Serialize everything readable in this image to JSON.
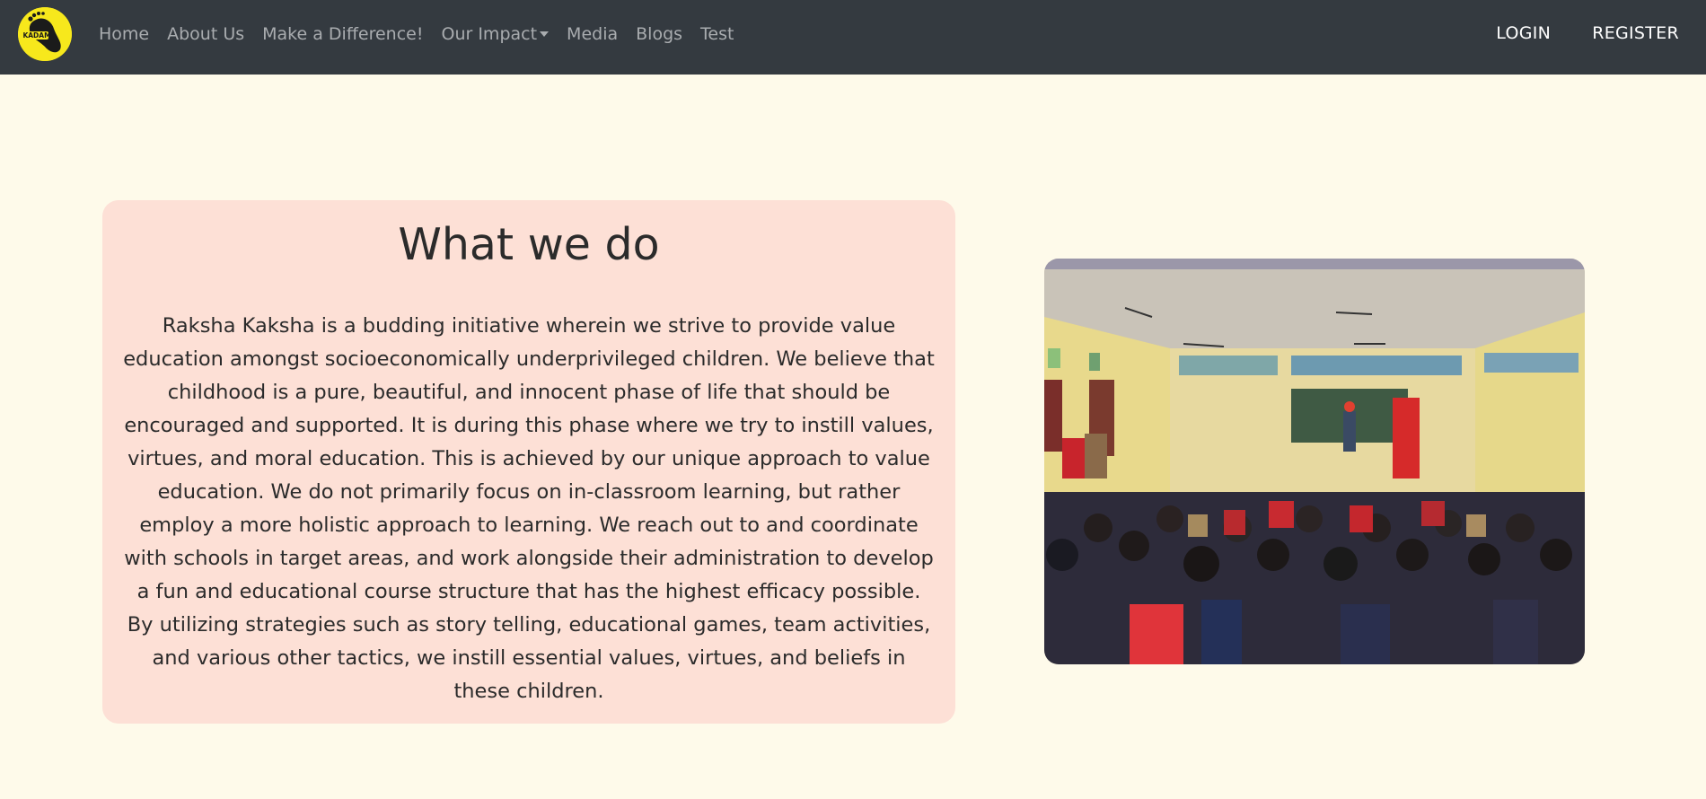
{
  "brand": {
    "logo_text": "KADAM",
    "logo_color": "#f7e81c"
  },
  "nav": {
    "items": [
      {
        "label": "Home"
      },
      {
        "label": "About Us"
      },
      {
        "label": "Make a Difference!"
      },
      {
        "label": "Our Impact"
      },
      {
        "label": "Media"
      },
      {
        "label": "Blogs"
      },
      {
        "label": "Test"
      }
    ],
    "login": "LOGIN",
    "register": "REGISTER"
  },
  "section": {
    "title": "What we do",
    "body": "Raksha Kaksha is a budding initiative wherein we strive to provide value education amongst socioeconomically underprivileged children. We believe that childhood is a pure, beautiful, and innocent phase of life that should be encouraged and supported. It is during this phase where we try to instill values, virtues, and moral education. This is achieved by our unique approach to value education. We do not primarily focus on in-classroom learning, but rather employ a more holistic approach to learning. We reach out to and coordinate with schools in target areas, and work alongside their administration to develop a fun and educational course structure that has the highest efficacy possible. By utilizing strategies such as story telling, educational games, team activities, and various other tactics, we instill essential values, virtues, and beliefs in these children."
  },
  "colors": {
    "navbar_bg": "#343a40",
    "page_bg": "#fefaea",
    "card_bg": "#fde0d6"
  }
}
